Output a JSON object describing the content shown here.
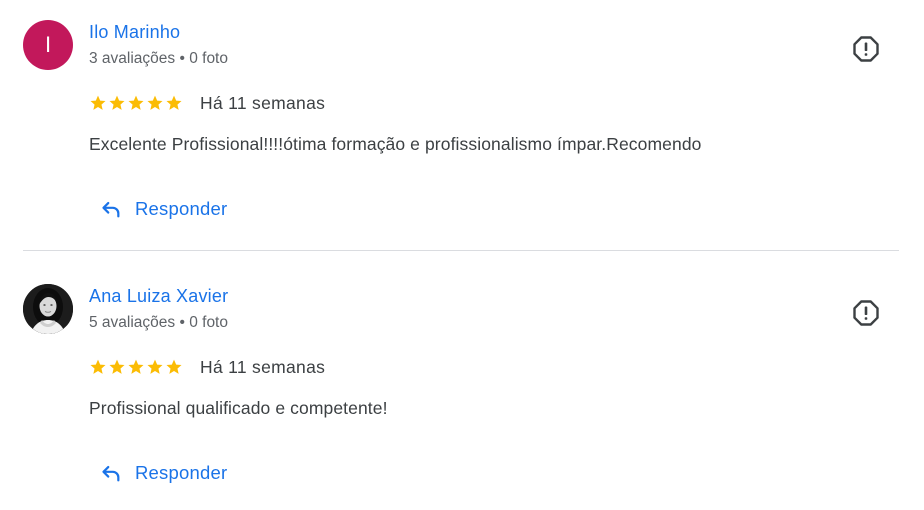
{
  "reviews": [
    {
      "avatar_letter": "I",
      "avatar_color": "#c2185b",
      "author": "Ilo Marinho",
      "meta": "3 avaliações • 0 foto",
      "rating": 5,
      "date": "Há 11 semanas",
      "text": "Excelente Profissional!!!!ótima formação e profissionalismo ímpar.Recomendo",
      "reply_label": "Responder"
    },
    {
      "avatar_letter": "",
      "author": "Ana Luiza Xavier",
      "meta": "5 avaliações • 0 foto",
      "rating": 5,
      "date": "Há 11 semanas",
      "text": "Profissional qualificado e competente!",
      "reply_label": "Responder"
    }
  ],
  "colors": {
    "link": "#1a73e8",
    "star": "#fbbc04",
    "divider": "#dadce0"
  },
  "icons": {
    "report": "report-icon",
    "reply": "reply-icon",
    "star": "star-icon"
  }
}
